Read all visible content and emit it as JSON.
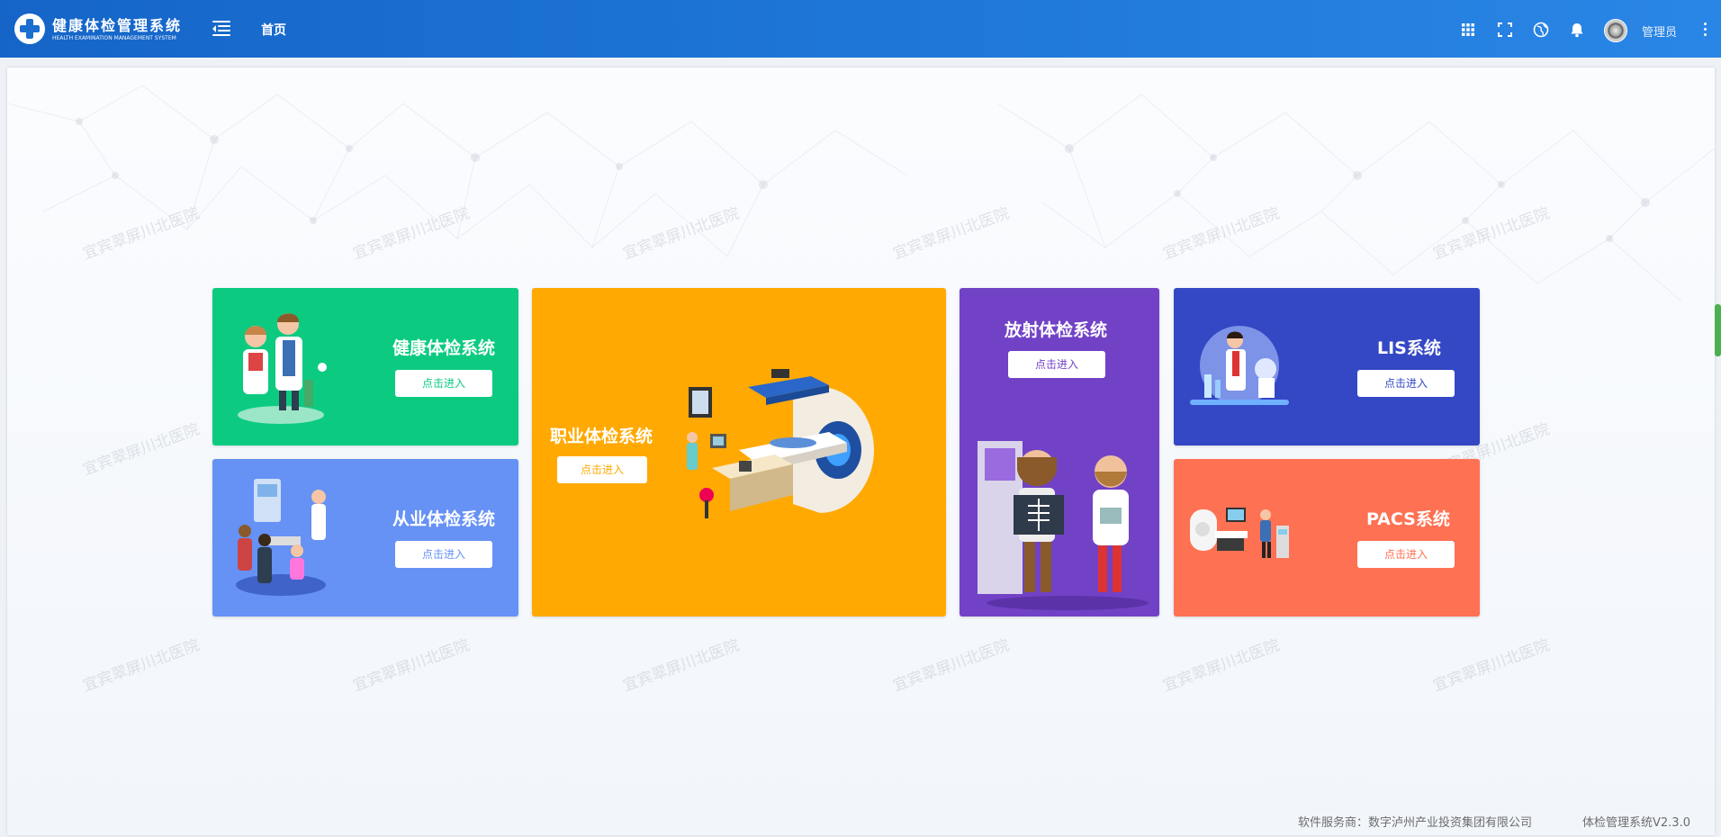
{
  "header": {
    "brand_title": "健康体检管理系统",
    "brand_subtitle": "HEALTH EXAMINATION MANAGEMENT SYSTEM",
    "nav_home": "首页",
    "user_name": "管理员",
    "icons": [
      "menu-collapse-icon",
      "apps-grid-icon",
      "fullscreen-icon",
      "globe-icon",
      "bell-icon",
      "more-vertical-icon"
    ]
  },
  "watermark_text": "宜宾翠屏川北医院",
  "cards": {
    "health": {
      "title": "健康体检系统",
      "button": "点击进入",
      "color": "#0ccb81",
      "button_text_color": "#0ccb81"
    },
    "employment": {
      "title": "从业体检系统",
      "button": "点击进入",
      "color": "#6691f5",
      "button_text_color": "#6691f5"
    },
    "occupational": {
      "title": "职业体检系统",
      "button": "点击进入",
      "color": "#ffa902",
      "button_text_color": "#ffa902"
    },
    "radiation": {
      "title": "放射体检系统",
      "button": "点击进入",
      "color": "#7142c6",
      "button_text_color": "#7142c6"
    },
    "lis": {
      "title": "LIS系统",
      "button": "点击进入",
      "color": "#3448c5",
      "button_text_color": "#3448c5"
    },
    "pacs": {
      "title": "PACS系统",
      "button": "点击进入",
      "color": "#fe7153",
      "button_text_color": "#fe7153"
    }
  },
  "footer": {
    "provider": "软件服务商：数字泸州产业投资集团有限公司",
    "version": "体检管理系统V2.3.0"
  }
}
